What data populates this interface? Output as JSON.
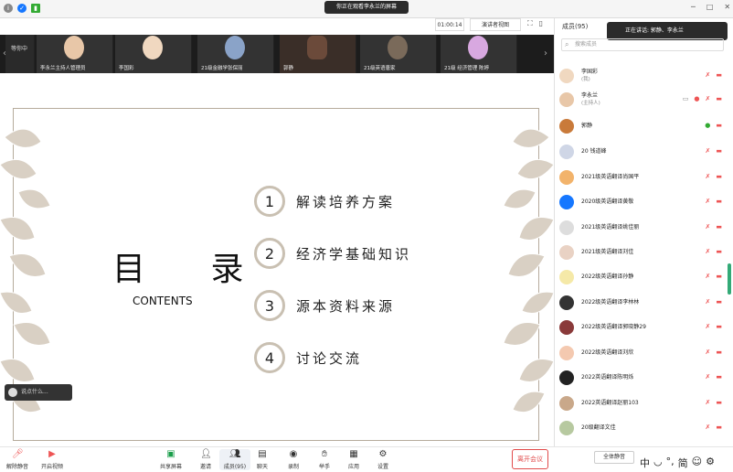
{
  "colors": {
    "accent": "#1677ff",
    "danger": "#e14b4b",
    "frame": "#b6ab9c",
    "circle": "#c9c0b2",
    "leaf": "#d9d0c4"
  },
  "topbar": {
    "share_banner": "你正在观看李永兰的屏幕",
    "timer": "01:00:14",
    "view_mode": "演讲者视图",
    "icons": [
      "info-icon",
      "shield-icon",
      "signal-icon"
    ]
  },
  "window": {
    "min": "─",
    "max": "□",
    "close": "✕"
  },
  "strip": {
    "first_tile": "等你中",
    "tiles": [
      {
        "name": "李永兰主持人管理员"
      },
      {
        "name": "李国彩"
      },
      {
        "name": "21级金融学张保丽"
      },
      {
        "name": "郭静"
      },
      {
        "name": "21级英语唐家"
      },
      {
        "name": "21级 经济管理 陈婷"
      }
    ]
  },
  "slide": {
    "title": "目 录",
    "subtitle": "CONTENTS",
    "items": [
      {
        "num": "1",
        "label": "解读培养方案"
      },
      {
        "num": "2",
        "label": "经济学基础知识"
      },
      {
        "num": "3",
        "label": "源本资料来源"
      },
      {
        "num": "4",
        "label": "讨论交流"
      }
    ]
  },
  "speak_pill": "说点什么...",
  "toolbar": {
    "mute": "解除静音",
    "video": "开启视频",
    "share": "共享屏幕",
    "invite": "邀请",
    "members": "成员(95)",
    "chat": "聊天",
    "record": "录制",
    "hand": "举手",
    "apps": "应用",
    "settings": "设置",
    "leave": "离开会议"
  },
  "sidebar": {
    "header": "成员(95)",
    "speaking": "正在讲话: 郭静、李永兰",
    "search_placeholder": "搜索成员",
    "members": [
      {
        "name": "李国彩",
        "sub": "(我)",
        "mic": "off"
      },
      {
        "name": "李永兰",
        "sub": "(主持人)",
        "mic": "off"
      },
      {
        "name": "郭静",
        "sub": "",
        "mic": "on"
      },
      {
        "name": "20 钱道峰",
        "sub": "",
        "mic": "off"
      },
      {
        "name": "2021级英语翻译尚国平",
        "sub": "",
        "mic": "off"
      },
      {
        "name": "2020级英语翻译黄敬",
        "sub": "",
        "mic": "off"
      },
      {
        "name": "2021级英语翻译姚佳丽",
        "sub": "",
        "mic": "off"
      },
      {
        "name": "2021级英语翻译刘佳",
        "sub": "",
        "mic": "off"
      },
      {
        "name": "2022级英语翻译孙静",
        "sub": "",
        "mic": "off"
      },
      {
        "name": "2022级英语翻译李林林",
        "sub": "",
        "mic": "off"
      },
      {
        "name": "2022级英语翻译郭晓静29",
        "sub": "",
        "mic": "off"
      },
      {
        "name": "2022级英语翻译刘欣",
        "sub": "",
        "mic": "off"
      },
      {
        "name": "2022英语翻译陈明烁",
        "sub": "",
        "mic": "off"
      },
      {
        "name": "2022英语翻译赵丽103",
        "sub": "",
        "mic": "off"
      },
      {
        "name": "20级翻译文佳",
        "sub": "",
        "mic": "off"
      }
    ],
    "mute_all": "全体静音",
    "ime": [
      "中",
      "◡",
      "°,",
      "简",
      "☺",
      "⚙"
    ]
  }
}
